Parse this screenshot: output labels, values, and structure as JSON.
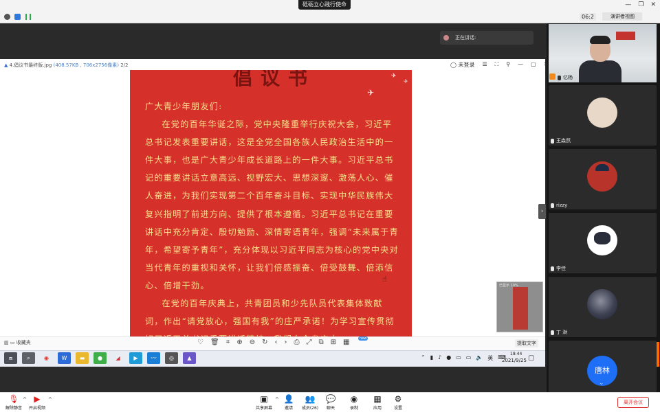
{
  "meeting": {
    "title": "砥砺立心践行使命",
    "timer": "06:2",
    "view_label": "演讲者视图"
  },
  "speaker_bubble": "正在讲话:",
  "viewer": {
    "filename": "4.倡议书最终版.jpg",
    "fileinfo": "(408.57KB , 706x2756像素)",
    "page": "2/2",
    "login_label": "未登录",
    "poster_heading": "倡议书",
    "paragraphs": [
      "广大青少年朋友们:",
      "在党的百年华诞之际，党中央隆重举行庆祝大会，习近平总书记发表重要讲话，这是全党全国各族人民政治生活中的一件大事，也是广大青少年成长道路上的一件大事。习近平总书记的重要讲话立意高远、视野宏大、思想深邃、激荡人心、催人奋进，为我们实现第二个百年奋斗目标、实现中华民族伟大复兴指明了前进方向、提供了根本遵循。习近平总书记在重要讲话中充分肯定、殷切勉励、深情寄语青年，强调“未来属于青年，希望寄予青年”，充分体现以习近平同志为核心的党中央对当代青年的重视和关怀，让我们倍感振奋、倍受鼓舞、倍添信心、倍增干劲。",
      "在党的百年庆典上，共青团员和少先队员代表集体致献词，作出“请党放心，强国有我”的庄严承诺！为学习宣传贯彻好习近平总书记重要讲话精神，我们向全省广大"
    ],
    "toolbar_left": "收藏夹",
    "new_badge": "new",
    "extract_label": "提取文字",
    "thumb_label": "已显示 10%"
  },
  "taskbar": {
    "time": "18:44",
    "date": "2021/9/25",
    "ime": "英"
  },
  "participants": [
    {
      "name": "亿杨",
      "kind": "video"
    },
    {
      "name": "王森然",
      "kind": "avatar"
    },
    {
      "name": "rizzy",
      "kind": "avatar"
    },
    {
      "name": "李佳",
      "kind": "avatar"
    },
    {
      "name": "丁 澍",
      "kind": "avatar"
    },
    {
      "name": "唐林",
      "kind": "initials"
    }
  ],
  "bottom_toolbar": {
    "mute": "解除静音",
    "video": "开启视频",
    "share": "共享屏幕",
    "invite": "邀请",
    "participants": "成员(26)",
    "chat": "聊天",
    "record": "录制",
    "apps": "应用",
    "settings": "设置",
    "end": "离开会议"
  },
  "colors": {
    "poster_red": "#d6302b",
    "poster_text": "#f6e08a",
    "accent_blue": "#1e6ff5",
    "end_red": "#e02f2f"
  }
}
